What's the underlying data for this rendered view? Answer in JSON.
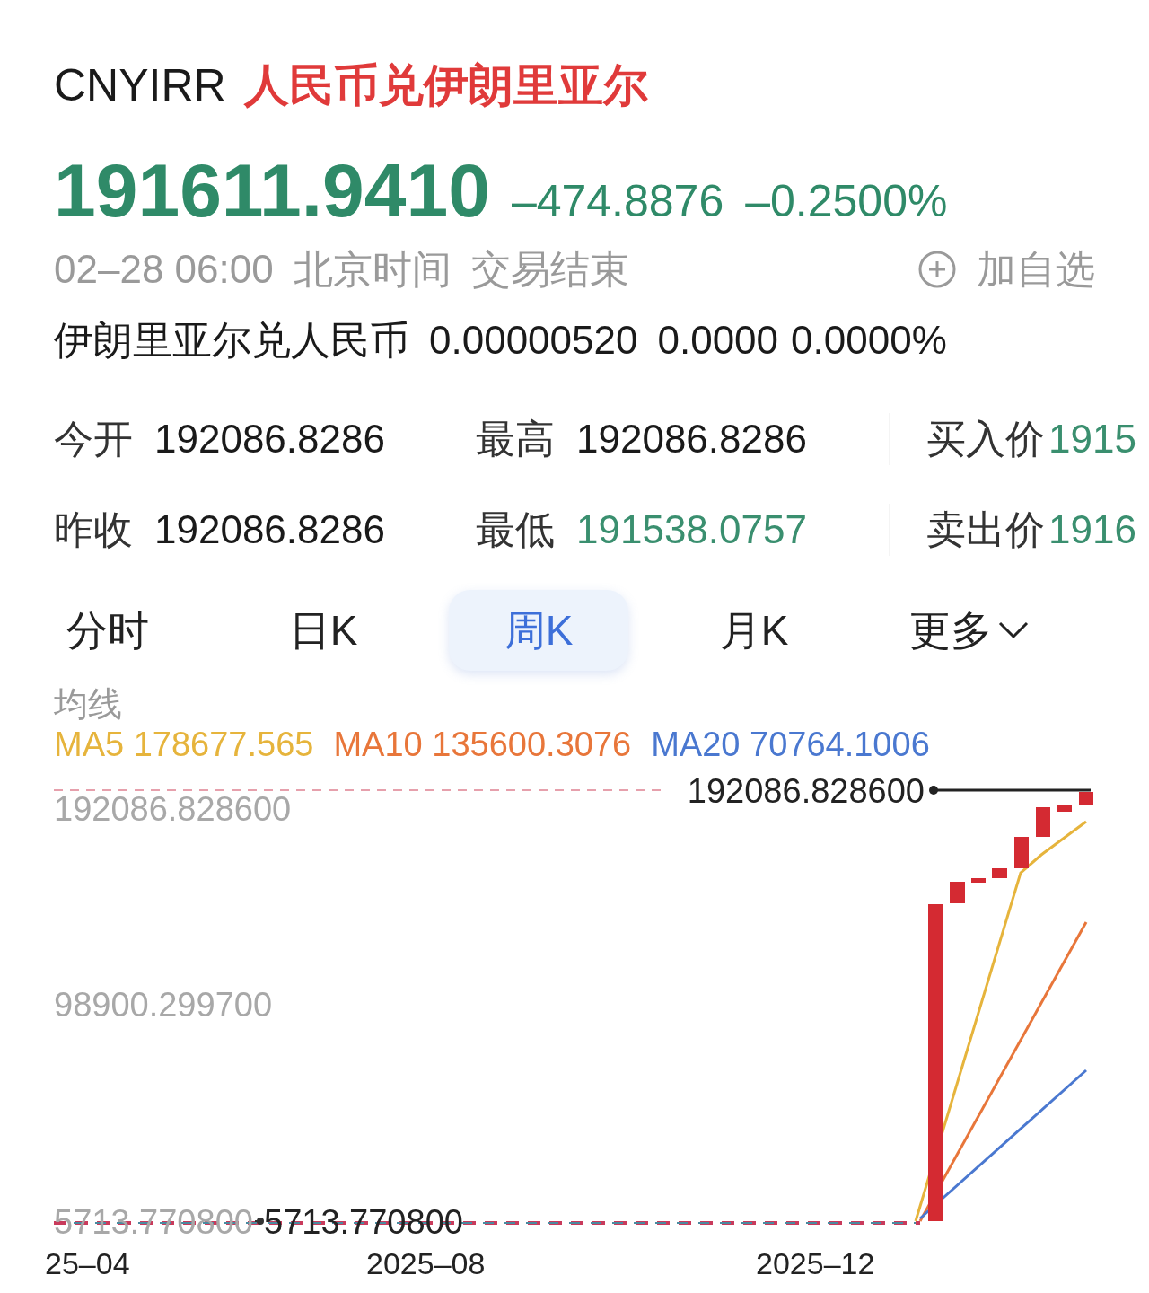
{
  "header": {
    "symbol": "CNYIRR",
    "name": "人民币兑伊朗里亚尔"
  },
  "quote": {
    "price": "191611.9410",
    "change": "–474.8876",
    "change_pct": "–0.2500%"
  },
  "status": {
    "time": "02–28 06:00",
    "timezone": "北京时间",
    "state": "交易结束",
    "watchlist_button": "加自选"
  },
  "inverse": {
    "label": "伊朗里亚尔兑人民币",
    "price": "0.00000520",
    "change": "0.0000",
    "change_pct": "0.0000%"
  },
  "stats": [
    {
      "label": "今开",
      "value": "192086.8286",
      "color": "#1a1a1a"
    },
    {
      "label": "最高",
      "value": "192086.8286",
      "color": "#1a1a1a"
    },
    {
      "label": "买入价",
      "value": "1915",
      "color": "#3a8f6f"
    },
    {
      "label": "昨收",
      "value": "192086.8286",
      "color": "#1a1a1a"
    },
    {
      "label": "最低",
      "value": "191538.0757",
      "color": "#3a8f6f"
    },
    {
      "label": "卖出价",
      "value": "1916",
      "color": "#3a8f6f"
    }
  ],
  "tabs": [
    {
      "label": "分时",
      "selected": false,
      "kind": "tab"
    },
    {
      "label": "日K",
      "selected": false,
      "kind": "tab"
    },
    {
      "label": "周K",
      "selected": true,
      "kind": "tab"
    },
    {
      "label": "月K",
      "selected": false,
      "kind": "tab"
    },
    {
      "label": "更多",
      "selected": false,
      "kind": "menu"
    }
  ],
  "chart": {
    "legend_title": "均线",
    "moving_averages": [
      {
        "label": "MA5 178677.565",
        "color": "#e6b43c"
      },
      {
        "label": "MA10 135600.3076",
        "color": "#e8763a"
      },
      {
        "label": "MA20 70764.1006",
        "color": "#4a78d0"
      }
    ],
    "y_labels": [
      "192086.828600",
      "98900.299700",
      "5713.770800"
    ],
    "high_marker": "192086.828600",
    "low_marker": "5713.770800",
    "x_labels": [
      "25–04",
      "2025–08",
      "2025–12"
    ]
  }
}
